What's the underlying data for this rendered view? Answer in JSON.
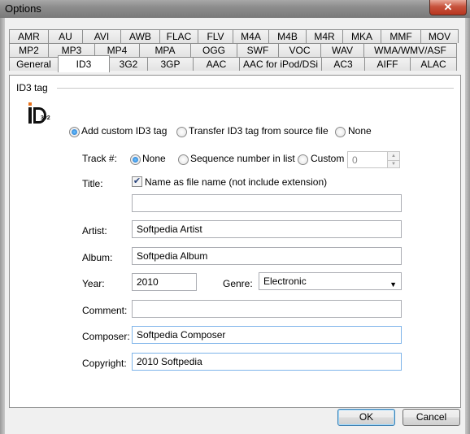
{
  "window": {
    "title": "Options",
    "close_glyph": "✕"
  },
  "tabs": {
    "row1": [
      "AMR",
      "AU",
      "AVI",
      "AWB",
      "FLAC",
      "FLV",
      "M4A",
      "M4B",
      "M4R",
      "MKA",
      "MMF",
      "MOV"
    ],
    "row2": [
      "MP2",
      "MP3",
      "MP4",
      "MPA",
      "OGG",
      "SWF",
      "VOC",
      "WAV",
      "WMA/WMV/ASF"
    ],
    "row3": [
      "General",
      "ID3",
      "3G2",
      "3GP",
      "AAC",
      "AAC for iPod/DSi",
      "AC3",
      "AIFF",
      "ALAC"
    ],
    "active": "ID3"
  },
  "id3": {
    "group_label": "ID3 tag",
    "logo_icon": "id3-logo-icon",
    "logo_text": {
      "id": "iD",
      "version": "3v2"
    },
    "mode_options": [
      "Add custom ID3 tag",
      "Transfer ID3 tag from source file",
      "None"
    ],
    "mode_selected": "Add custom ID3 tag",
    "track": {
      "label": "Track #:",
      "options": [
        "None",
        "Sequence number in list",
        "Custom"
      ],
      "selected": "None",
      "custom_value": "0"
    },
    "title": {
      "label": "Title:",
      "checkbox_label": "Name as file name (not include extension)",
      "checked": true,
      "check_glyph": "✔",
      "value": ""
    },
    "artist": {
      "label": "Artist:",
      "value": "Softpedia Artist"
    },
    "album": {
      "label": "Album:",
      "value": "Softpedia Album"
    },
    "year": {
      "label": "Year:",
      "value": "2010"
    },
    "genre": {
      "label": "Genre:",
      "value": "Electronic",
      "arrow": "▼"
    },
    "comment": {
      "label": "Comment:",
      "value": ""
    },
    "composer": {
      "label": "Composer:",
      "value": "Softpedia Composer"
    },
    "copyright": {
      "label": "Copyright:",
      "value": "2010 Softpedia"
    }
  },
  "buttons": {
    "ok": "OK",
    "cancel": "Cancel"
  }
}
